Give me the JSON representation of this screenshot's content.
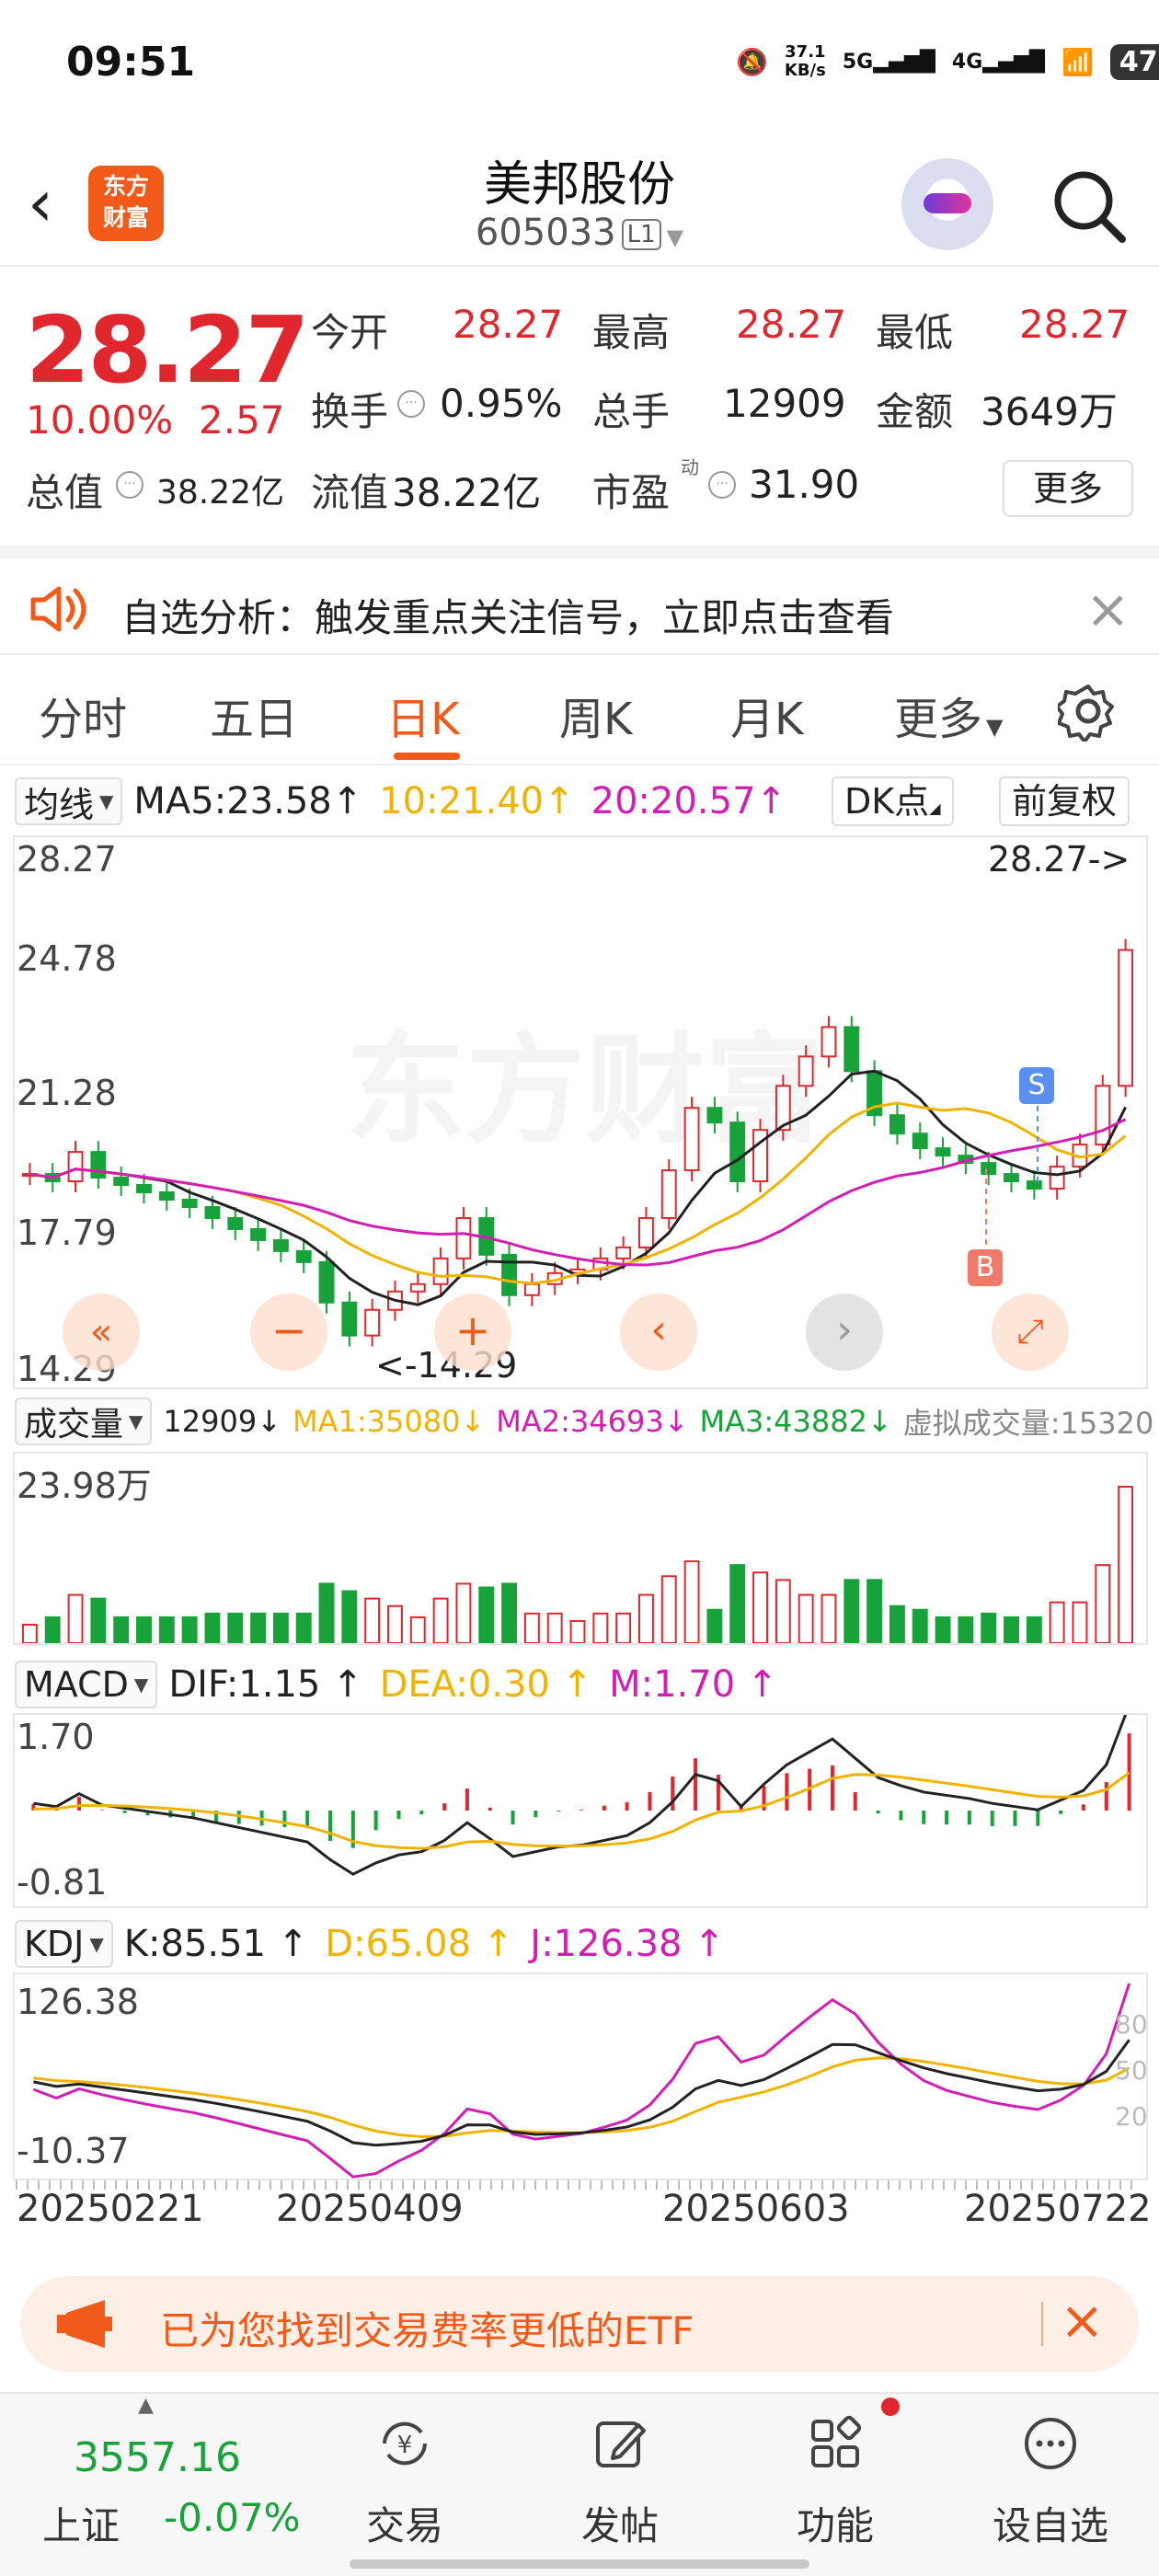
{
  "status": {
    "time": "09:51",
    "net_speed": "37.1\nKB/s",
    "net_top": "37.1",
    "net_bottom": "KB/s",
    "signal1": "5G",
    "signal2": "4G",
    "battery": "47"
  },
  "header": {
    "logo_line1": "东方",
    "logo_line2": "财富",
    "stock_name": "美邦股份",
    "stock_code": "605033",
    "level_tag": "L1"
  },
  "quote": {
    "price": "28.27",
    "change_pct": "10.00%",
    "change_abs": "2.57",
    "open_label": "今开",
    "open": "28.27",
    "high_label": "最高",
    "high": "28.27",
    "low_label": "最低",
    "low": "28.27",
    "turnover_label": "换手",
    "turnover": "0.95%",
    "volume_label": "总手",
    "volume": "12909",
    "amount_label": "金额",
    "amount": "3649万",
    "mcap_label": "总值",
    "mcap": "38.22亿",
    "float_label": "流值",
    "float_value": "38.22亿",
    "pe_label": "市盈",
    "pe_sup": "动",
    "pe": "31.90",
    "more_label": "更多"
  },
  "notice": {
    "text": "自选分析：触发重点关注信号，立即点击查看"
  },
  "tabs": {
    "items": [
      "分时",
      "五日",
      "日K",
      "周K",
      "月K",
      "更多"
    ],
    "active_index": 2
  },
  "ma_bar": {
    "dropdown": "均线",
    "ma5": "MA5:23.58",
    "ma10": "10:21.40",
    "ma20": "20:20.57",
    "dk": "DK点",
    "fq": "前复权"
  },
  "kchart": {
    "y_labels": [
      "28.27",
      "24.78",
      "21.28",
      "17.79",
      "14.29"
    ],
    "last_price_tag": "28.27->",
    "min_tag": "<-14.29",
    "signal_s": "S",
    "signal_b": "B"
  },
  "vol_bar": {
    "dropdown": "成交量",
    "vol": "12909",
    "ma1": "MA1:35080",
    "ma2": "MA2:34693",
    "ma3": "MA3:43882",
    "virtual": "虚拟成交量:15320",
    "max_label": "23.98万"
  },
  "macd_bar": {
    "dropdown": "MACD",
    "dif": "DIF:1.15",
    "dea": "DEA:0.30",
    "m": "M:1.70",
    "top_label": "1.70",
    "bottom_label": "-0.81"
  },
  "kdj_bar": {
    "dropdown": "KDJ",
    "k": "K:85.51",
    "d": "D:65.08",
    "j": "J:126.38",
    "top_label": "126.38",
    "bottom_label": "-10.37",
    "lvl80": "80",
    "lvl50": "50",
    "lvl20": "20"
  },
  "dates": [
    "20250221",
    "20250409",
    "20250603",
    "20250722"
  ],
  "etf_banner": {
    "text": "已为您找到交易费率更低的ETF"
  },
  "bottom_nav": {
    "index_value": "3557.16",
    "index_name": "上证",
    "index_change": "-0.07%",
    "items": [
      "交易",
      "发帖",
      "功能",
      "设自选"
    ]
  },
  "chart_data": {
    "type": "candlestick",
    "title": "",
    "ylim": [
      14.29,
      28.27
    ],
    "x_range": [
      "20250221",
      "20250722"
    ],
    "x_ticks": [
      "20250221",
      "20250409",
      "20250603",
      "20250722"
    ],
    "closes_approx": [
      19.6,
      19.4,
      20.2,
      19.5,
      19.3,
      19.1,
      18.9,
      18.7,
      18.4,
      18.1,
      17.8,
      17.5,
      17.2,
      16.1,
      15.2,
      15.9,
      16.4,
      16.6,
      17.3,
      18.4,
      17.4,
      16.3,
      16.6,
      16.9,
      17.0,
      17.3,
      17.6,
      18.4,
      19.7,
      21.4,
      21.0,
      19.4,
      20.8,
      22.0,
      22.8,
      23.6,
      22.4,
      21.2,
      20.7,
      20.3,
      20.1,
      19.9,
      19.6,
      19.4,
      19.2,
      19.8,
      20.4,
      22.0,
      25.7
    ],
    "ma_values_last": {
      "MA5": 23.58,
      "MA10": 21.4,
      "MA20": 20.57
    }
  }
}
